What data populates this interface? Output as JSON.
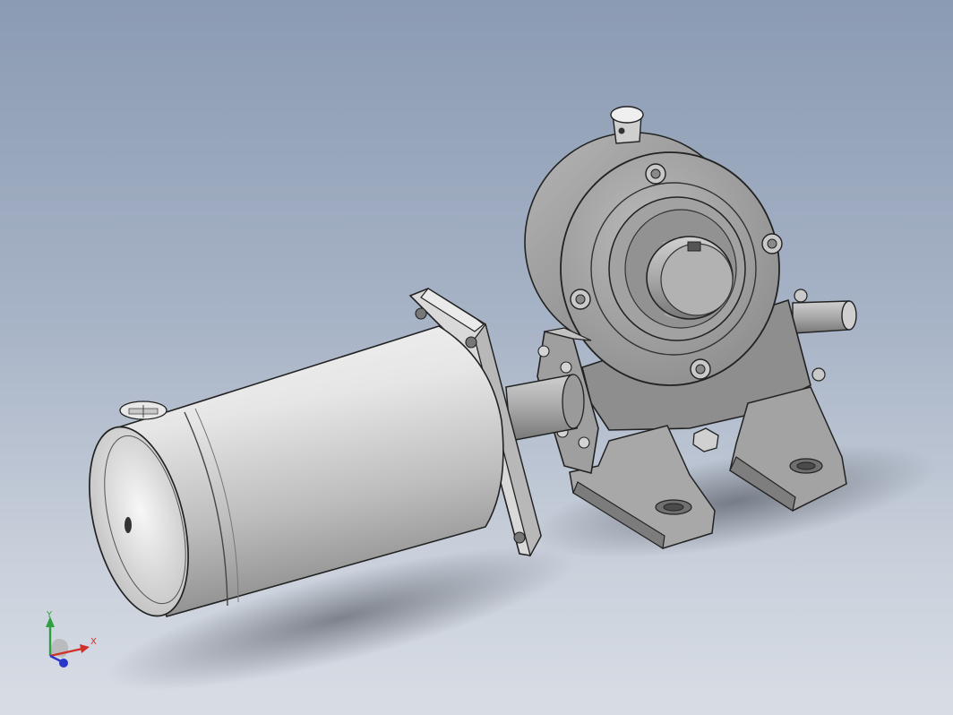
{
  "view": {
    "background_top": "#8b9bb3",
    "background_bottom": "#d8dde5",
    "model_color": "#9a9a9a",
    "motor_color": "#d6d6d6"
  },
  "triad": {
    "x_label": "X",
    "y_label": "Y",
    "x_color": "#d0302a",
    "y_color": "#2fa040",
    "z_color": "#2a36c8"
  }
}
